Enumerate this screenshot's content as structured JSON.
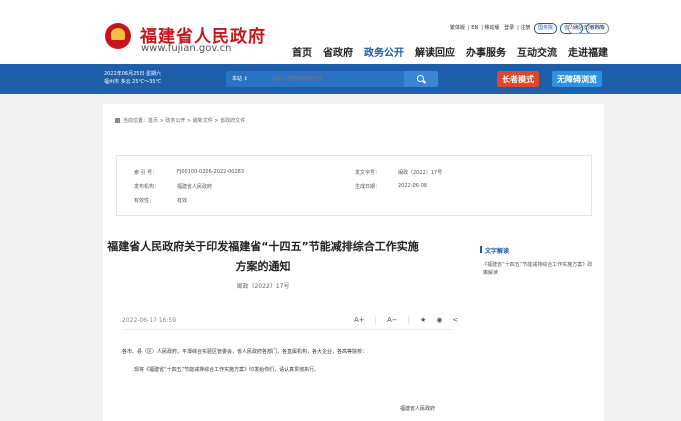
{
  "header": {
    "site_title": "福建省人民政府",
    "site_url": "www.fujian.gov.cn",
    "tags": [
      "国务院",
      "省人大",
      "省政协"
    ],
    "util_links": [
      "繁体版",
      "EN",
      "移动版",
      "登录",
      "注册"
    ],
    "util_button": "网站支持IPV6",
    "nav": [
      "首页",
      "省政府",
      "政务公开",
      "解读回应",
      "办事服务",
      "互动交流",
      "走进福建"
    ],
    "active_nav": "政务公开"
  },
  "bar": {
    "date": "2022年06月25日 星期六",
    "weather": "福州市 多云 25℃～35℃",
    "search_scope": "本站 ⇕",
    "search_placeholder": "请输入想要搜索的内容",
    "elder_mode": "长者模式",
    "accessible_mode": "无障碍浏览",
    "accent": "#1d5faa"
  },
  "breadcrumb": "当前位置：首页 > 政务公开 > 最新文件 > 省政府文件",
  "meta": {
    "index_label": "索 引 号：",
    "index_value": "FJ00100-0206-2022-00283",
    "issuer_label": "发布机构：",
    "issuer_value": "福建省人民政府",
    "validity_label": "有效性：",
    "validity_value": "有效",
    "docno_label": "发文字号：",
    "docno_value": "闽政〔2022〕17号",
    "created_label": "生成日期：",
    "created_value": "2022-06-08"
  },
  "document": {
    "title_line1": "福建省人民政府关于印发福建省“十四五”节能减排综合工作实施",
    "title_line2": "方案的通知",
    "doc_number": "闽政〔2022〕17号",
    "publish_date": "2022-06-17 16:59",
    "tools": [
      "A+",
      "A−",
      "★",
      "◉",
      "<"
    ],
    "para1": "各市、县（区）人民政府，平潭综合实验区管委会，省人民政府各部门，各直属机构，各大企业，各高等院校：",
    "para2": "现将《福建省“十四五”节能减排综合工作实施方案》印发给你们，请认真贯彻执行。",
    "signer": "福建省人民政府"
  },
  "sidebar": {
    "title": "文字解读",
    "link": "·《福建省“十四五”节能减排综合工作实施方案》政策解读"
  }
}
